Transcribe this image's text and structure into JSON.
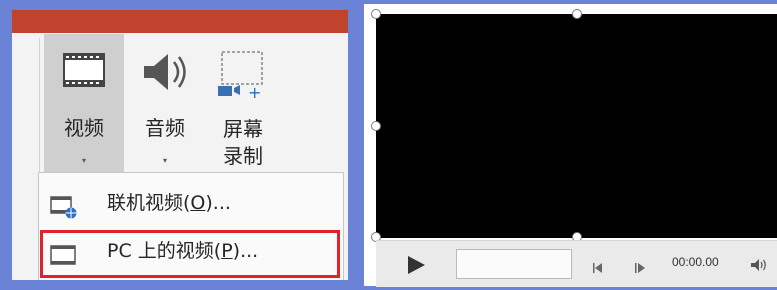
{
  "ribbon": {
    "video_label": "视频",
    "audio_label": "音频",
    "record_label_line1": "屏幕",
    "record_label_line2": "录制",
    "caret": "▾"
  },
  "menu": {
    "online_video": {
      "text": "联机视频(",
      "key": "O",
      "suffix": ")..."
    },
    "pc_video": {
      "text": "PC 上的视频(",
      "key": "P",
      "suffix": ")..."
    }
  },
  "player": {
    "time": "00:00.00",
    "icons": [
      "play-icon",
      "step-back-icon",
      "step-forward-icon",
      "volume-icon"
    ]
  },
  "colors": {
    "titlebar": "#c0432d",
    "highlight": "#e0232b",
    "background": "#6a83d6",
    "video": "#000000"
  }
}
